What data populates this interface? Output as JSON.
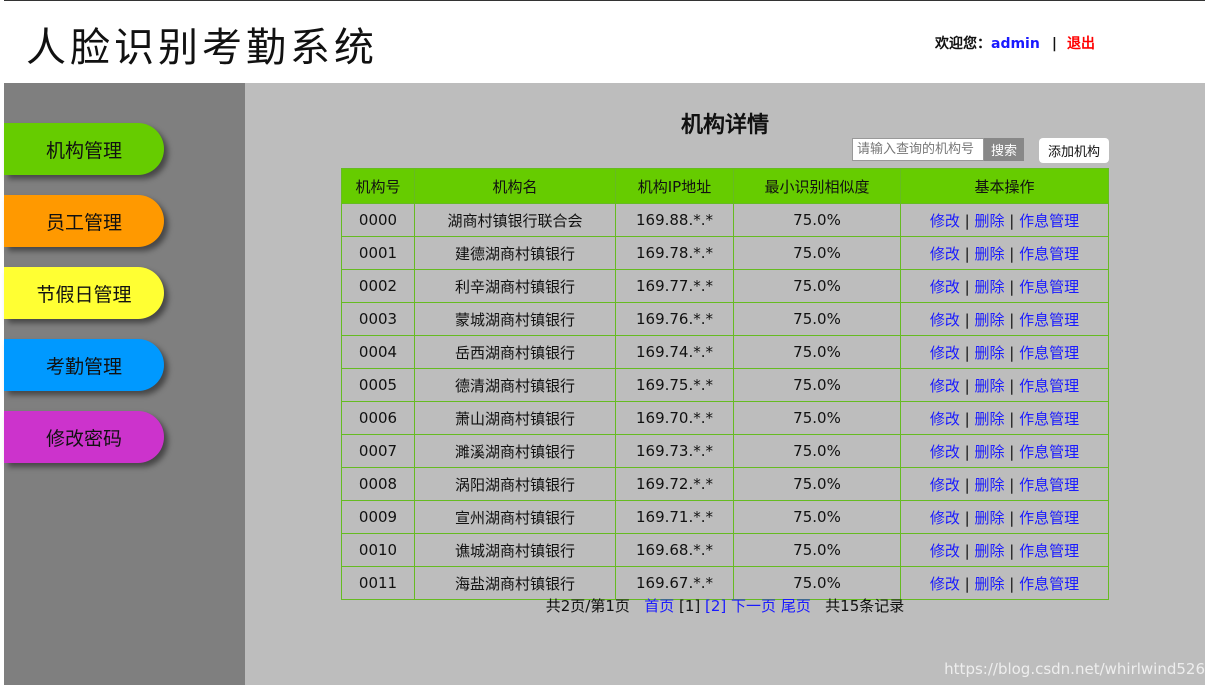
{
  "header": {
    "logo": "人脸识别考勤系统",
    "welcome_label": "欢迎您：",
    "username": "admin",
    "separator": "|",
    "logout_label": "退出"
  },
  "sidebar": {
    "items": [
      {
        "label": "机构管理",
        "color": "#66cc00"
      },
      {
        "label": "员工管理",
        "color": "#ff9900"
      },
      {
        "label": "节假日管理",
        "color": "#ffff33"
      },
      {
        "label": "考勤管理",
        "color": "#0099ff"
      },
      {
        "label": "修改密码",
        "color": "#cc33cc"
      }
    ]
  },
  "main": {
    "title": "机构详情",
    "search_placeholder": "请输入查询的机构号",
    "search_button": "搜索",
    "add_button": "添加机构",
    "table": {
      "headers": [
        "机构号",
        "机构名",
        "机构IP地址",
        "最小识别相似度",
        "基本操作"
      ],
      "ops": {
        "edit": "修改",
        "delete": "删除",
        "manage": "作息管理",
        "sep": "|"
      },
      "rows": [
        {
          "id": "0000",
          "name": "湖商村镇银行联合会",
          "ip": "169.88.*.*",
          "sim": "75.0%"
        },
        {
          "id": "0001",
          "name": "建德湖商村镇银行",
          "ip": "169.78.*.*",
          "sim": "75.0%"
        },
        {
          "id": "0002",
          "name": "利辛湖商村镇银行",
          "ip": "169.77.*.*",
          "sim": "75.0%"
        },
        {
          "id": "0003",
          "name": "蒙城湖商村镇银行",
          "ip": "169.76.*.*",
          "sim": "75.0%"
        },
        {
          "id": "0004",
          "name": "岳西湖商村镇银行",
          "ip": "169.74.*.*",
          "sim": "75.0%"
        },
        {
          "id": "0005",
          "name": "德清湖商村镇银行",
          "ip": "169.75.*.*",
          "sim": "75.0%"
        },
        {
          "id": "0006",
          "name": "萧山湖商村镇银行",
          "ip": "169.70.*.*",
          "sim": "75.0%"
        },
        {
          "id": "0007",
          "name": "濉溪湖商村镇银行",
          "ip": "169.73.*.*",
          "sim": "75.0%"
        },
        {
          "id": "0008",
          "name": "涡阳湖商村镇银行",
          "ip": "169.72.*.*",
          "sim": "75.0%"
        },
        {
          "id": "0009",
          "name": "宣州湖商村镇银行",
          "ip": "169.71.*.*",
          "sim": "75.0%"
        },
        {
          "id": "0010",
          "name": "谯城湖商村镇银行",
          "ip": "169.68.*.*",
          "sim": "75.0%"
        },
        {
          "id": "0011",
          "name": "海盐湖商村镇银行",
          "ip": "169.67.*.*",
          "sim": "75.0%"
        }
      ]
    },
    "pager": {
      "info": "共2页/第1页",
      "first": "首页",
      "current": "[1]",
      "page2": "[2]",
      "next": "下一页",
      "last": "尾页",
      "total": "共15条记录"
    }
  },
  "watermark": "https://blog.csdn.net/whirlwind526"
}
